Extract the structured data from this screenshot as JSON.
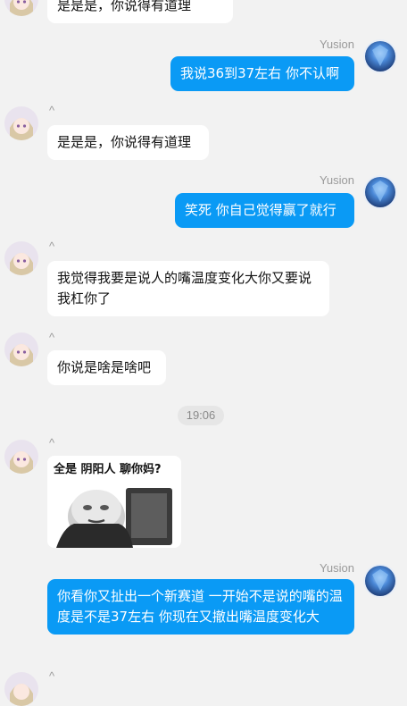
{
  "messages": [
    {
      "id": "m0",
      "side": "in",
      "name": "",
      "text": "是是是，你说得有道理"
    },
    {
      "id": "m1",
      "side": "out",
      "name": "Yusion",
      "text": "我说36到37左右 你不认啊"
    },
    {
      "id": "m2",
      "side": "in",
      "name": "^",
      "text": "是是是，你说得有道理"
    },
    {
      "id": "m3",
      "side": "out",
      "name": "Yusion",
      "text": "笑死 你自己觉得赢了就行"
    },
    {
      "id": "m4",
      "side": "in",
      "name": "^",
      "text": "我觉得我要是说人的嘴温度变化大你又要说我杠你了"
    },
    {
      "id": "m5",
      "side": "in",
      "name": "^",
      "text": "你说是啥是啥吧"
    },
    {
      "id": "m6",
      "side": "in",
      "name": "^",
      "type": "sticker",
      "sticker_caption": "全是 阴阳人  聊你妈?"
    },
    {
      "id": "m7",
      "side": "out",
      "name": "Yusion",
      "text": "你看你又扯出一个新赛道 一开始不是说的嘴的温度是不是37左右  你现在又撤出嘴温度变化大"
    },
    {
      "id": "m8",
      "side": "in",
      "name": "^"
    }
  ],
  "timestamp": "19:06",
  "colors": {
    "background": "#f2f2f2",
    "out_bubble": "#0a9af5",
    "in_bubble": "#ffffff",
    "name": "#9a9a9a"
  },
  "icons": {
    "incoming_avatar": "anime-girl-avatar",
    "outgoing_avatar": "blue-crystal-avatar"
  }
}
